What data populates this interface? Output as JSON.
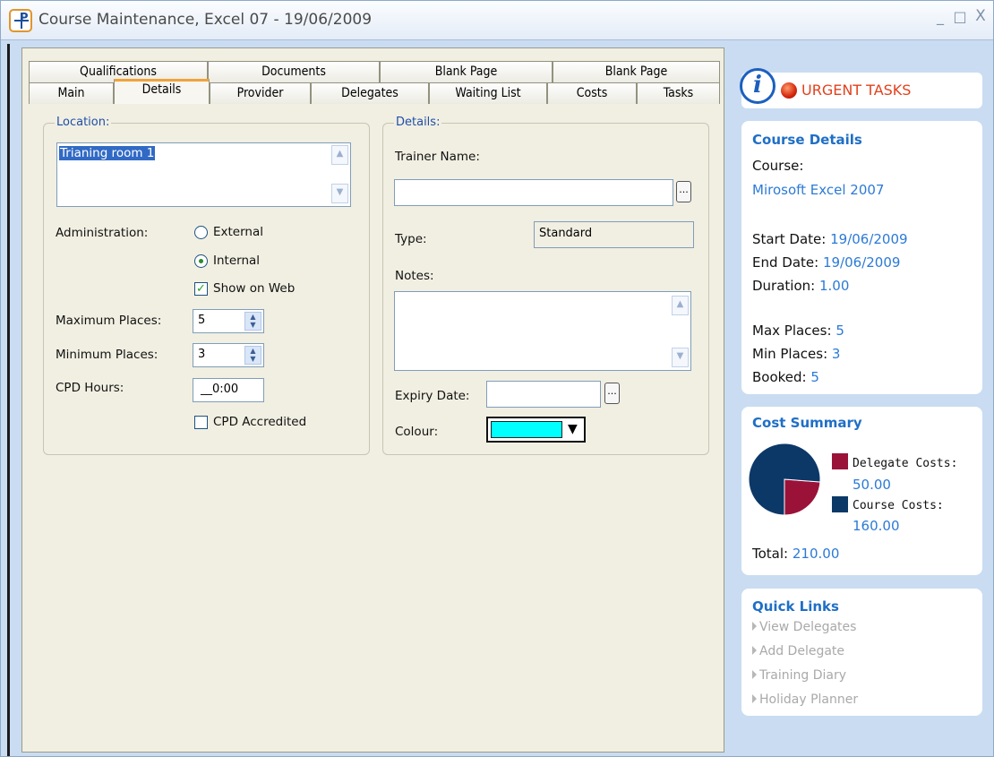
{
  "window": {
    "title": "Course Maintenance, Excel 07 - 19/06/2009",
    "app_icon_letter": "P",
    "minimize": "_",
    "maximize": "□",
    "close": "X"
  },
  "tabs_row1": [
    "Qualifications",
    "Documents",
    "Blank Page",
    "Blank Page"
  ],
  "tabs_row2": [
    "Main",
    "Details",
    "Provider",
    "Delegates",
    "Waiting List",
    "Costs",
    "Tasks"
  ],
  "location": {
    "legend": "Location:",
    "value": "Trianing room 1",
    "administration_label": "Administration:",
    "external_label": "External",
    "internal_label": "Internal",
    "administration_selected": "Internal",
    "show_on_web_label": "Show on Web",
    "show_on_web_checked": true,
    "max_places_label": "Maximum Places:",
    "max_places": "5",
    "min_places_label": "Minimum Places:",
    "min_places": "3",
    "cpd_hours_label": "CPD Hours:",
    "cpd_hours": "__0:00",
    "cpd_accredited_label": "CPD Accredited",
    "cpd_accredited_checked": false
  },
  "details": {
    "legend": "Details:",
    "trainer_label": "Trainer Name:",
    "trainer_value": "",
    "type_label": "Type:",
    "type_value": "Standard",
    "notes_label": "Notes:",
    "notes_value": "",
    "expiry_label": "Expiry Date:",
    "expiry_value": "",
    "colour_label": "Colour:",
    "colour_value": "#00ffff",
    "ellipsis": "..."
  },
  "urgent": {
    "label": "URGENT TASKS",
    "info_glyph": "i"
  },
  "course_details": {
    "title": "Course Details",
    "course_label": "Course:",
    "course_name": "Mirosoft Excel 2007",
    "start_label": "Start Date:",
    "start_date": "19/06/2009",
    "end_label": "End Date:",
    "end_date": "19/06/2009",
    "duration_label": "Duration:",
    "duration": "1.00",
    "max_label": "Max Places:",
    "max_places": "5",
    "min_label": "Min Places:",
    "min_places": "3",
    "booked_label": "Booked:",
    "booked": "5"
  },
  "cost_summary": {
    "title": "Cost Summary",
    "delegate_label": "Delegate Costs:",
    "delegate_value": "50.00",
    "course_label": "Course Costs:",
    "course_value": "160.00",
    "total_label": "Total:",
    "total_value": "210.00",
    "delegate_color": "#9b1239",
    "course_color": "#0c3868"
  },
  "chart_data": {
    "type": "pie",
    "categories": [
      "Delegate Costs",
      "Course Costs"
    ],
    "values": [
      50,
      160
    ]
  },
  "quick_links": {
    "title": "Quick Links",
    "items": [
      "View Delegates",
      "Add Delegate",
      "Training Diary",
      "Holiday Planner"
    ]
  }
}
